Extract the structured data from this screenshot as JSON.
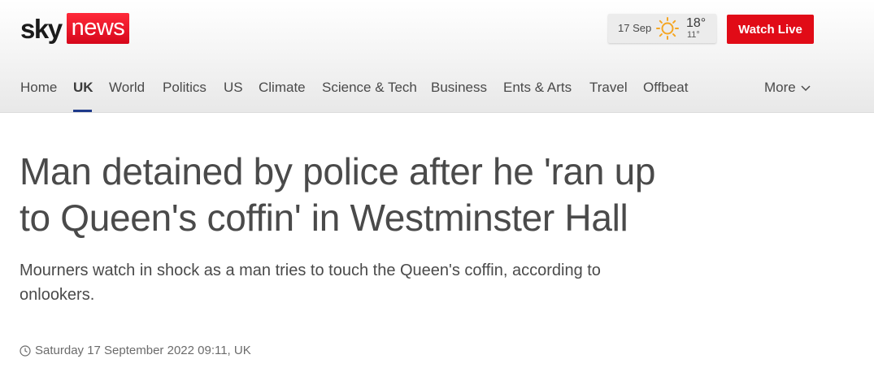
{
  "brand": {
    "sky": "sky",
    "news": "news",
    "color_red": "#e10b17"
  },
  "weather": {
    "date": "17 Sep",
    "high": "18°",
    "low": "11°",
    "icon": "sun-icon"
  },
  "header": {
    "watch_live_label": "Watch Live"
  },
  "nav": {
    "items": [
      {
        "label": "Home"
      },
      {
        "label": "UK",
        "active": true
      },
      {
        "label": "World"
      },
      {
        "label": "Politics"
      },
      {
        "label": "US"
      },
      {
        "label": "Climate"
      },
      {
        "label": "Science & Tech"
      },
      {
        "label": "Business"
      },
      {
        "label": "Ents & Arts"
      },
      {
        "label": "Travel"
      },
      {
        "label": "Offbeat"
      }
    ],
    "more_label": "More",
    "active_color": "#1e3a8a"
  },
  "article": {
    "headline": "Man detained by police after he 'ran up to Queen's coffin' in Westminster Hall",
    "standfirst": "Mourners watch in shock as a man tries to touch the Queen's coffin, according to onlookers.",
    "timestamp": "Saturday 17 September 2022 09:11, UK"
  }
}
